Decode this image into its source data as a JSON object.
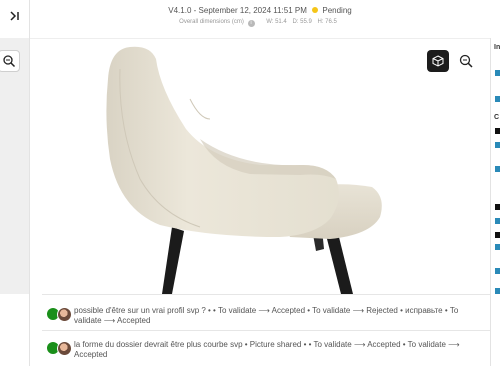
{
  "header": {
    "version": "V4.1.0",
    "date": "September 12, 2024 11:51 PM",
    "status": "Pending",
    "status_color": "#f5c518",
    "dimensions_label": "Overall dimensions (cm)",
    "width": "W: 51.4",
    "depth": "D: 55.9",
    "height": "H: 76.5"
  },
  "icons": {
    "collapse": "collapse-panel-icon",
    "zoom": "zoom-icon",
    "cube": "cube-3d-icon",
    "info": "info-icon"
  },
  "right_panel": {
    "label_1": "In",
    "label_2": "C"
  },
  "comments": [
    {
      "text": "possible d'être sur un vrai profil svp ? • • To validate ⟶ Accepted • To validate ⟶ Rejected • исправьте • To validate ⟶ Accepted"
    },
    {
      "text": "la forme du dossier devrait être plus courbe svp • Picture shared • • To validate ⟶ Accepted • To validate ⟶ Accepted"
    }
  ]
}
